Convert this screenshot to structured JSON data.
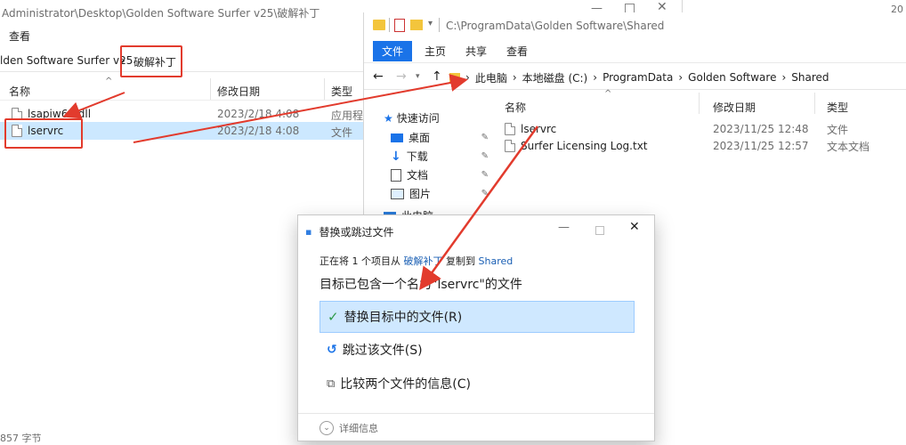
{
  "left_window": {
    "title_path": "Administrator\\Desktop\\Golden Software Surfer v25\\破解补丁",
    "ribbon": {
      "view": "查看"
    },
    "address": {
      "folder": "lden Software Surfer v25",
      "current": "破解补丁",
      "sep": "›"
    },
    "columns": {
      "name": "名称",
      "date": "修改日期",
      "type": "类型"
    },
    "files": [
      {
        "name": "lsapiw64.dll",
        "date": "2023/2/18 4:08",
        "type": "应用程序"
      },
      {
        "name": "lservrc",
        "date": "2023/2/18 4:08",
        "type": "文件"
      }
    ],
    "status": "857 字节"
  },
  "right_window": {
    "path_label": "C:\\ProgramData\\Golden Software\\Shared",
    "ribbon_tabs": [
      "文件",
      "主页",
      "共享",
      "查看"
    ],
    "nav": {
      "back": "←",
      "forward": "→",
      "up": "↑"
    },
    "breadcrumb": [
      "此电脑",
      "本地磁盘 (C:)",
      "ProgramData",
      "Golden Software",
      "Shared"
    ],
    "breadcrumb_sep": "›",
    "sidebar": {
      "quick_access": "快速访问",
      "items": [
        "桌面",
        "下载",
        "文档",
        "图片"
      ],
      "partial": "此电脑"
    },
    "columns": {
      "name": "名称",
      "date": "修改日期",
      "type": "类型"
    },
    "files": [
      {
        "name": "lservrc",
        "date": "2023/11/25 12:48",
        "type": "文件"
      },
      {
        "name": "Surfer Licensing Log.txt",
        "date": "2023/11/25 12:57",
        "type": "文本文档"
      }
    ],
    "corner": "20"
  },
  "dialog": {
    "title": "替换或跳过文件",
    "info_prefix": "正在将 1 个项目从",
    "source": "破解补丁",
    "info_mid": "复制到",
    "dest": "Shared",
    "message": "目标已包含一个名为\"lservrc\"的文件",
    "options": [
      {
        "label": "替换目标中的文件(R)",
        "icon": "check-icon"
      },
      {
        "label": "跳过该文件(S)",
        "icon": "skip-icon"
      },
      {
        "label": "比较两个文件的信息(C)",
        "icon": "compare-icon"
      }
    ],
    "details": "详细信息"
  },
  "colors": {
    "accent": "#1a73e8",
    "arrow": "#e23b2d",
    "selected": "#cce8ff",
    "dialog_highlight": "#cfe8ff"
  }
}
